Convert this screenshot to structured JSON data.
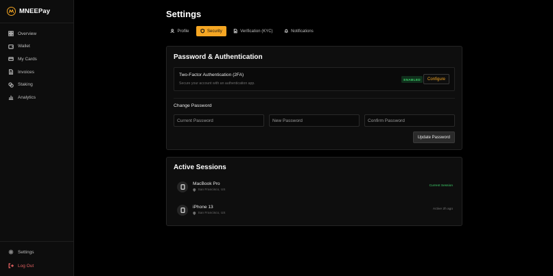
{
  "brand": {
    "name": "MNEEPay",
    "logo_icon": "logo-icon",
    "accent": "#f5a623"
  },
  "sidebar": {
    "items": [
      {
        "label": "Overview",
        "icon": "grid-icon"
      },
      {
        "label": "Wallet",
        "icon": "wallet-icon"
      },
      {
        "label": "My Cards",
        "icon": "card-icon"
      },
      {
        "label": "Invoices",
        "icon": "document-icon"
      },
      {
        "label": "Staking",
        "icon": "coins-icon"
      },
      {
        "label": "Analytics",
        "icon": "bar-chart-icon"
      }
    ],
    "bottom": [
      {
        "label": "Settings",
        "icon": "gear-icon"
      },
      {
        "label": "Log Out",
        "icon": "logout-icon"
      }
    ]
  },
  "page": {
    "title": "Settings"
  },
  "tabs": [
    {
      "label": "Profile",
      "icon": "user-icon",
      "active": false
    },
    {
      "label": "Security",
      "icon": "shield-icon",
      "active": true
    },
    {
      "label": "Verification (KYC)",
      "icon": "file-icon",
      "active": false
    },
    {
      "label": "Notifications",
      "icon": "bell-icon",
      "active": false
    }
  ],
  "security": {
    "title": "Password & Authentication",
    "tfa": {
      "title": "Two-Factor Authentication (2FA)",
      "description": "Secure your account with an authentication app.",
      "badge": "ENABLED",
      "configure_label": "Configure"
    },
    "change_password": {
      "heading": "Change Password",
      "current_placeholder": "Current Password",
      "new_placeholder": "New Password",
      "confirm_placeholder": "Confirm Password",
      "submit_label": "Update Password"
    }
  },
  "sessions": {
    "title": "Active Sessions",
    "items": [
      {
        "device": "MacBook Pro",
        "location": "San Francisco, US",
        "status": "Current Session",
        "icon": "device-icon",
        "current": true
      },
      {
        "device": "iPhone 13",
        "location": "San Francisco, US",
        "status": "Active 2h ago",
        "icon": "device-icon",
        "current": false
      }
    ]
  },
  "colors": {
    "status_active": "#3ecf6a",
    "danger": "#e06060",
    "background": "#000000"
  }
}
